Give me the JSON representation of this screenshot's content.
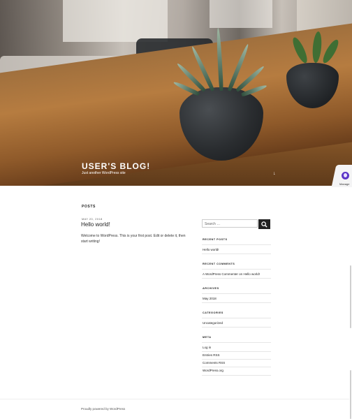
{
  "header": {
    "site_title": "USER'S BLOG!",
    "site_description": "Just another WordPress site",
    "scroll_icon": "arrow-down-icon"
  },
  "manage_badge": {
    "label": "Manage",
    "icon": "manage-icon",
    "color": "#5b35c7"
  },
  "main": {
    "posts_heading": "POSTS",
    "post": {
      "date": "MAY 20, 2018",
      "title": "Hello world!",
      "body": "Welcome to WordPress. This is your first post. Edit or delete it, then start writing!"
    }
  },
  "sidebar": {
    "search_placeholder": "Search …",
    "search_icon": "search-icon",
    "recent_posts": {
      "title": "RECENT POSTS",
      "items": [
        "Hello world!"
      ]
    },
    "recent_comments": {
      "title": "RECENT COMMENTS",
      "items": [
        "A WordPress Commenter on Hello world!"
      ]
    },
    "archives": {
      "title": "ARCHIVES",
      "items": [
        "May 2018"
      ]
    },
    "categories": {
      "title": "CATEGORIES",
      "items": [
        "Uncategorized"
      ]
    },
    "meta": {
      "title": "META",
      "items": [
        "Log in",
        "Entries RSS",
        "Comments RSS",
        "WordPress.org"
      ]
    }
  },
  "footer": {
    "text": "Proudly powered by WordPress"
  }
}
